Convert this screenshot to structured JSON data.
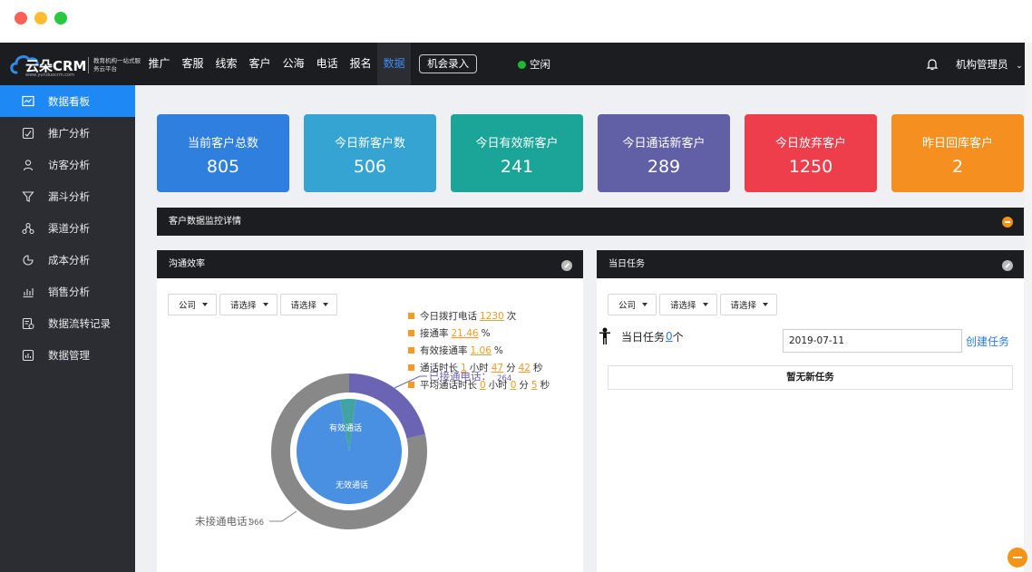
{
  "app": {
    "logo_name": "云朵CRM",
    "logo_url": "www.yunduocrm.com",
    "logo_tagline": "教育机构一站式服务云平台"
  },
  "nav": {
    "items": [
      "推广",
      "客服",
      "线索",
      "客户",
      "公海",
      "电话",
      "报名",
      "数据"
    ],
    "active_index": 7,
    "action_button": "机会录入",
    "status": "空闲",
    "status_color": "#1bb934",
    "bell_icon": "bell-icon",
    "user": "机构管理员"
  },
  "sidebar": {
    "items": [
      {
        "label": "数据看板",
        "icon": "dashboard-icon",
        "active": true
      },
      {
        "label": "推广分析",
        "icon": "chart-check-icon"
      },
      {
        "label": "访客分析",
        "icon": "user-icon"
      },
      {
        "label": "漏斗分析",
        "icon": "funnel-icon"
      },
      {
        "label": "渠道分析",
        "icon": "channel-icon"
      },
      {
        "label": "成本分析",
        "icon": "pie-icon"
      },
      {
        "label": "销售分析",
        "icon": "sales-icon"
      },
      {
        "label": "数据流转记录",
        "icon": "flow-record-icon"
      },
      {
        "label": "数据管理",
        "icon": "data-manage-icon"
      }
    ],
    "active_color": "#1e88f5"
  },
  "cards": [
    {
      "title": "当前客户总数",
      "value": "805",
      "color": "#2e7fde"
    },
    {
      "title": "今日新客户数",
      "value": "506",
      "color": "#35a4d3"
    },
    {
      "title": "今日有效新客户",
      "value": "241",
      "color": "#1aa598"
    },
    {
      "title": "今日通话新客户",
      "value": "289",
      "color": "#615fa6"
    },
    {
      "title": "今日放弃客户",
      "value": "1250",
      "color": "#ee3d4b"
    },
    {
      "title": "昨日回库客户",
      "value": "2",
      "color": "#f59020"
    }
  ],
  "monitor": {
    "title": "客户数据监控详情"
  },
  "comm": {
    "title": "沟通效率",
    "filters": [
      "公司",
      "请选择",
      "请选择"
    ],
    "stats": {
      "dial_label": "今日拨打电话",
      "dial_value": "1230",
      "dial_unit": "次",
      "rate_label": "接通率",
      "rate_value": "21.46",
      "rate_unit": "%",
      "eff_label": "有效接通率",
      "eff_value": "1.06",
      "eff_unit": "%",
      "dur_label": "通话时长",
      "dur_h": "1",
      "dur_h_unit": "小时",
      "dur_m": "47",
      "dur_m_unit": "分",
      "dur_s": "42",
      "dur_s_unit": "秒",
      "avg_label": "平均通话时长",
      "avg_h": "0",
      "avg_h_unit": "小时",
      "avg_m": "0",
      "avg_m_unit": "分",
      "avg_s": "5",
      "avg_s_unit": "秒"
    }
  },
  "chart_data": {
    "type": "pie",
    "outer_ring": [
      {
        "label": "已接通电话：",
        "value": 264,
        "color": "#6b63b3"
      },
      {
        "label": "未接通电话：",
        "value": 966,
        "color": "#888888"
      }
    ],
    "inner_pie": [
      {
        "label": "有效通话",
        "value": 13,
        "color": "#42a4a2"
      },
      {
        "label": "无效通话",
        "value": 251,
        "color": "#4a90e2"
      }
    ]
  },
  "tasks": {
    "title": "当日任务",
    "filters": [
      "公司",
      "请选择",
      "请选择"
    ],
    "label": "当日任务",
    "count": "0",
    "count_unit": "个",
    "date": "2019-07-11",
    "create": "创建任务",
    "empty": "暂无新任务"
  }
}
